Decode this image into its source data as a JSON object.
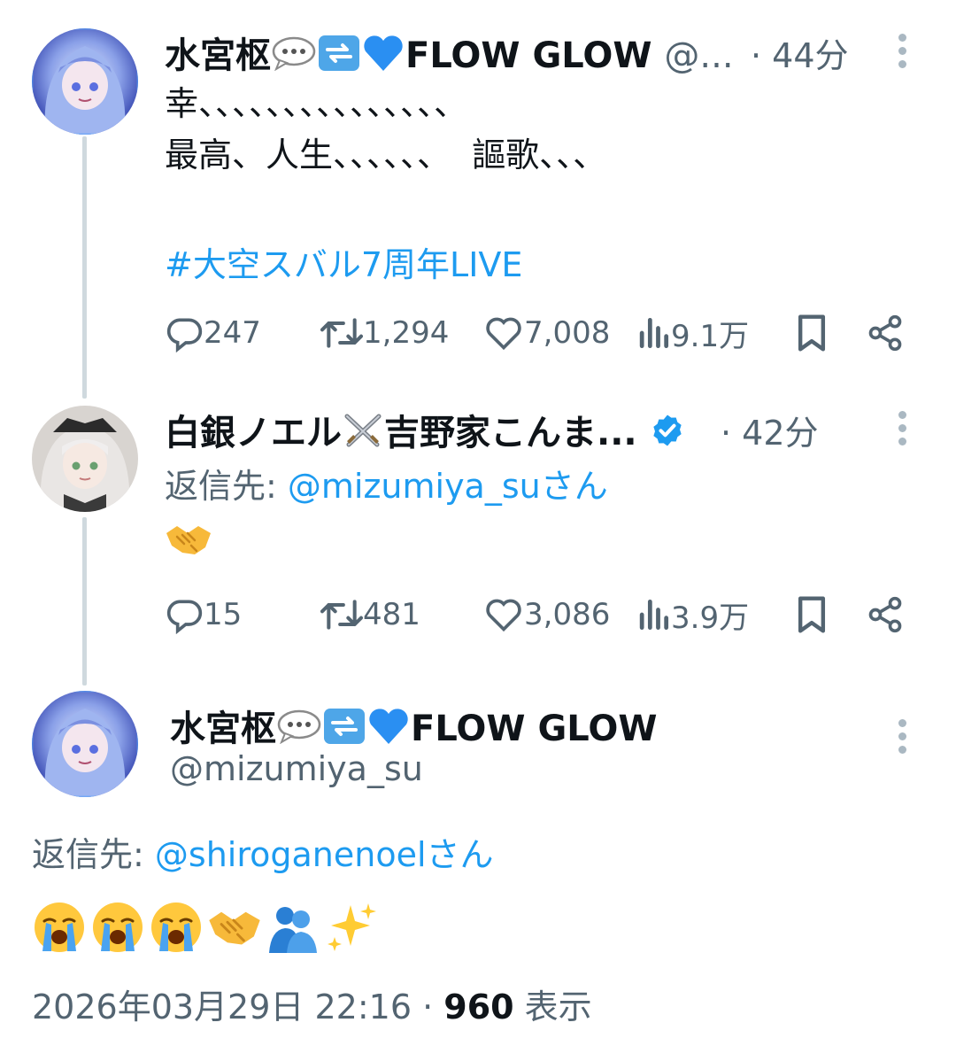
{
  "tweet1": {
    "display_name": "水宮枢",
    "name_suffix": "FLOW GLOW",
    "handle_truncated": "@...",
    "time": "· 44分",
    "body_lines": [
      "幸、、、、、、、、、、、、、、、",
      "最高、人生、、、、、、  謳歌、、、"
    ],
    "hashtag": "#大空スバル7周年LIVE",
    "stats": {
      "replies": "247",
      "retweets": "1,294",
      "likes": "7,008",
      "views": "9.1万"
    }
  },
  "tweet2": {
    "display_name": "白銀ノエル",
    "name_suffix": "吉野家こんま...",
    "time": "· 42分",
    "reply_label": "返信先: ",
    "reply_mention": "@mizumiya_su",
    "reply_suffix": "さん",
    "body_emoji": "handshake",
    "stats": {
      "replies": "15",
      "retweets": "481",
      "likes": "3,086",
      "views": "3.9万"
    }
  },
  "main_tweet": {
    "display_name": "水宮枢",
    "name_suffix": "FLOW GLOW",
    "handle": "@mizumiya_su",
    "reply_label": "返信先: ",
    "reply_mention": "@shiroganenoel",
    "reply_suffix": "さん",
    "emojis": [
      "loudly-crying-face",
      "loudly-crying-face",
      "loudly-crying-face",
      "handshake",
      "people-hugging",
      "sparkles"
    ],
    "timestamp": "2026年03月29日 22:16 · ",
    "view_count": "960",
    "view_label": " 表示"
  },
  "icons": [
    "reply-icon",
    "retweet-icon",
    "like-icon",
    "views-icon",
    "bookmark-icon",
    "share-icon",
    "more-icon",
    "verified-badge-icon"
  ],
  "colors": {
    "link": "#1d9bf0",
    "muted": "#536471",
    "thread_line": "#cfd9de",
    "text": "#0f1419"
  }
}
